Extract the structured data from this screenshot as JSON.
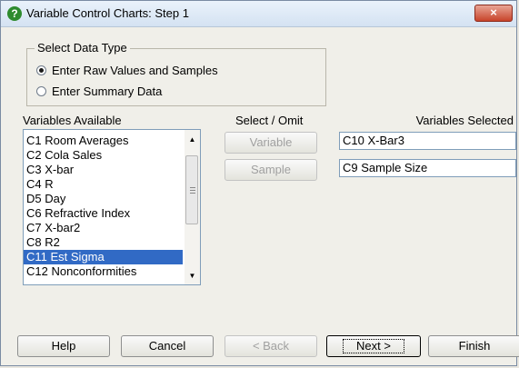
{
  "window": {
    "title": "Variable Control Charts: Step 1",
    "close_label": "×"
  },
  "data_type": {
    "group_label": "Select Data Type",
    "options": [
      {
        "label": "Enter Raw Values and Samples",
        "checked": true
      },
      {
        "label": "Enter Summary Data",
        "checked": false
      }
    ]
  },
  "variables_available": {
    "label": "Variables Available",
    "items": [
      {
        "label": "C1 Room Averages",
        "selected": false
      },
      {
        "label": "C2 Cola Sales",
        "selected": false
      },
      {
        "label": "C3 X-bar",
        "selected": false
      },
      {
        "label": "C4 R",
        "selected": false
      },
      {
        "label": "D5 Day",
        "selected": false
      },
      {
        "label": "C6 Refractive Index",
        "selected": false
      },
      {
        "label": "C7 X-bar2",
        "selected": false
      },
      {
        "label": "C8 R2",
        "selected": false
      },
      {
        "label": "C11 Est Sigma",
        "selected": true
      },
      {
        "label": "C12 Nonconformities",
        "selected": false
      }
    ]
  },
  "select_omit": {
    "label": "Select / Omit",
    "variable_button": "Variable",
    "sample_button": "Sample"
  },
  "variables_selected": {
    "label": "Variables Selected",
    "variable_value": "C10 X-Bar3",
    "sample_value": "C9 Sample Size"
  },
  "footer": {
    "help": "Help",
    "cancel": "Cancel",
    "back": "< Back",
    "next": "Next >",
    "finish": "Finish"
  }
}
